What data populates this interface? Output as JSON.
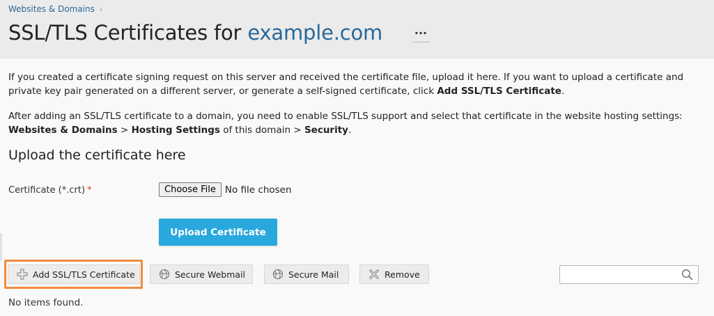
{
  "breadcrumb": {
    "item": "Websites & Domains",
    "separator": "›"
  },
  "header": {
    "title_prefix": "SSL/TLS Certificates for ",
    "domain": "example.com",
    "more": "···"
  },
  "intro": {
    "p1_text": "If you created a certificate signing request on this server and received the certificate file, upload it here. If you want to upload a certificate and private key pair generated on a different server, or generate a self-signed certificate, click ",
    "p1_bold": "Add SSL/TLS Certificate",
    "p1_end": ".",
    "p2_text": "After adding an SSL/TLS certificate to a domain, you need to enable SSL/TLS support and select that certificate in the website hosting settings: ",
    "p2_bold1": "Websites & Domains",
    "p2_sep1": " > ",
    "p2_bold2": "Hosting Settings",
    "p2_mid": " of this domain > ",
    "p2_bold3": "Security",
    "p2_end": "."
  },
  "upload": {
    "section_title": "Upload the certificate here",
    "field_label": "Certificate (*.crt)",
    "required_mark": "*",
    "choose_file_label": "Choose File",
    "no_file_text": "No file chosen",
    "upload_button": "Upload Certificate"
  },
  "toolbar": {
    "add_label": "Add SSL/TLS Certificate",
    "webmail_label": "Secure Webmail",
    "mail_label": "Secure Mail",
    "remove_label": "Remove",
    "search_value": "",
    "search_placeholder": ""
  },
  "list": {
    "empty_text": "No items found."
  },
  "icons": {
    "add": "plus-icon",
    "webmail": "globe-icon",
    "mail": "globe-icon",
    "remove": "x-icon",
    "search": "search-icon"
  },
  "colors": {
    "link": "#28689a",
    "primary_button": "#29a8de",
    "highlight": "#f28b3b",
    "required": "#d93e31"
  }
}
